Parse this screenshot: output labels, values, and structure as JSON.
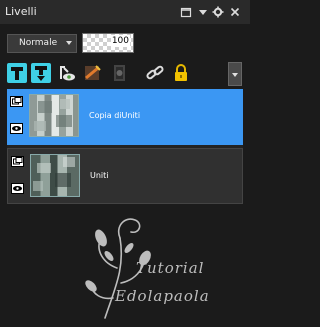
{
  "panel": {
    "title": "Livelli",
    "title_buttons": [
      "restore-icon",
      "menu-arrow-icon",
      "gear-icon",
      "close-icon"
    ]
  },
  "blend_mode": {
    "selected": "Normale"
  },
  "opacity": {
    "value": "100"
  },
  "toolbar": {
    "icons": [
      "new-layer-icon",
      "new-layer-down-icon",
      "layer-visibility-icon",
      "effects-icon",
      "mask-icon",
      "link-icon",
      "lock-icon",
      "dropdown-arrow-icon"
    ]
  },
  "layers": [
    {
      "name": "Copia diUniti",
      "selected": true
    },
    {
      "name": "Uniti",
      "selected": false
    }
  ],
  "watermark": {
    "line1": "Tutorial",
    "line2": "Edolapaola"
  },
  "colors": {
    "selection": "#3b97f3",
    "background": "#1b1b1b",
    "accent_cyan": "#3fd0e6"
  }
}
